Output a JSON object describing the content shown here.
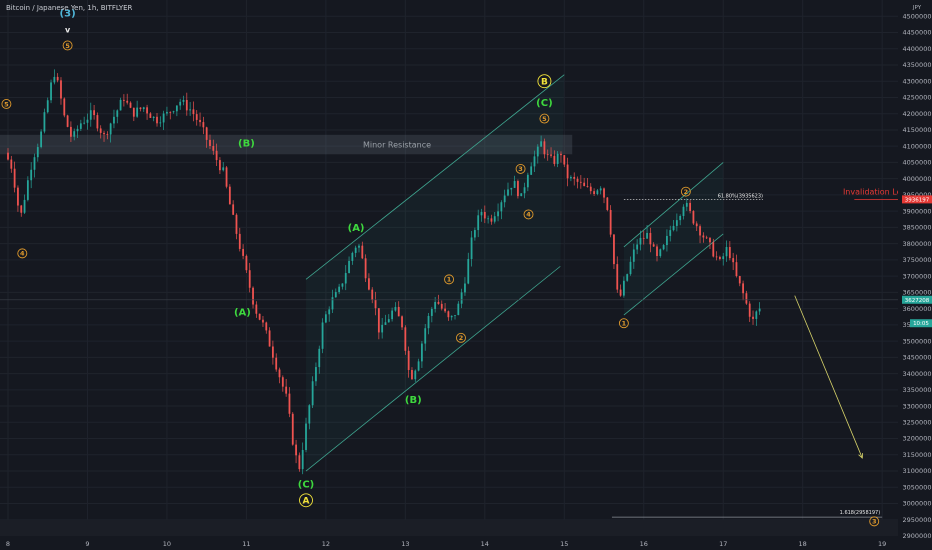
{
  "header": {
    "title": "Bitcoin / Japanese Yen, 1h, BITFLYER",
    "currency": "JPY"
  },
  "colors": {
    "background": "#151820",
    "bull": "#26a69a",
    "bear": "#ef5350",
    "wave_green": "#3ed83e",
    "wave_orange": "#e09a2c",
    "wave_yellow": "#f2e33a",
    "wave_cyan": "#4fb6d8",
    "invalidation": "#e53935",
    "forecast_arrow": "#d8d46a"
  },
  "chart_data": {
    "type": "candlestick",
    "symbol": "Bitcoin / Japanese Yen",
    "interval": "1h",
    "exchange": "BITFLYER",
    "y_range": [
      2900000,
      4550000
    ],
    "y_ticks": [
      2900000,
      2950000,
      3000000,
      3050000,
      3100000,
      3150000,
      3200000,
      3250000,
      3300000,
      3350000,
      3400000,
      3450000,
      3500000,
      3550000,
      3600000,
      3650000,
      3700000,
      3750000,
      3800000,
      3850000,
      3900000,
      3950000,
      4000000,
      4050000,
      4100000,
      4150000,
      4200000,
      4250000,
      4300000,
      4350000,
      4400000,
      4450000,
      4500000
    ],
    "y_tick_labels": [
      "2900000",
      "2950000",
      "3000000",
      "3050000",
      "3100000",
      "3150000",
      "3200000",
      "3250000",
      "3300000",
      "3350000",
      "3400000",
      "3450000",
      "3500000",
      "3550000",
      "3600000",
      "3650000",
      "3700000",
      "3750000",
      "3800000",
      "3850000",
      "3900000",
      "3950000",
      "4000000",
      "4050000",
      "4100000",
      "4150000",
      "4200000",
      "4250000",
      "4300000",
      "4350000",
      "4400000",
      "4450000",
      "4500000"
    ],
    "x_range": [
      8,
      19.3
    ],
    "x_ticks": [
      8,
      9,
      10,
      11,
      12,
      13,
      14,
      15,
      16,
      17,
      18,
      19
    ],
    "x_tick_labels": [
      "8",
      "9",
      "10",
      "11",
      "12",
      "13",
      "14",
      "15",
      "16",
      "17",
      "18",
      "19"
    ],
    "price_path": [
      [
        8.0,
        4080000
      ],
      [
        8.1,
        4030000
      ],
      [
        8.15,
        3940000
      ],
      [
        8.2,
        3880000
      ],
      [
        8.28,
        3980000
      ],
      [
        8.35,
        4060000
      ],
      [
        8.45,
        4130000
      ],
      [
        8.55,
        4250000
      ],
      [
        8.62,
        4330000
      ],
      [
        8.68,
        4280000
      ],
      [
        8.75,
        4190000
      ],
      [
        8.85,
        4120000
      ],
      [
        8.95,
        4170000
      ],
      [
        9.1,
        4200000
      ],
      [
        9.25,
        4130000
      ],
      [
        9.35,
        4180000
      ],
      [
        9.5,
        4250000
      ],
      [
        9.6,
        4200000
      ],
      [
        9.75,
        4220000
      ],
      [
        9.9,
        4180000
      ],
      [
        10.05,
        4200000
      ],
      [
        10.2,
        4240000
      ],
      [
        10.35,
        4210000
      ],
      [
        10.45,
        4170000
      ],
      [
        10.6,
        4090000
      ],
      [
        10.75,
        4020000
      ],
      [
        10.85,
        3900000
      ],
      [
        10.95,
        3800000
      ],
      [
        11.05,
        3700000
      ],
      [
        11.15,
        3600000
      ],
      [
        11.25,
        3550000
      ],
      [
        11.35,
        3480000
      ],
      [
        11.45,
        3400000
      ],
      [
        11.55,
        3320000
      ],
      [
        11.62,
        3200000
      ],
      [
        11.7,
        3100000
      ],
      [
        11.8,
        3250000
      ],
      [
        11.9,
        3400000
      ],
      [
        12.0,
        3550000
      ],
      [
        12.1,
        3620000
      ],
      [
        12.2,
        3650000
      ],
      [
        12.3,
        3720000
      ],
      [
        12.4,
        3790000
      ],
      [
        12.45,
        3800000
      ],
      [
        12.55,
        3700000
      ],
      [
        12.65,
        3620000
      ],
      [
        12.72,
        3520000
      ],
      [
        12.8,
        3560000
      ],
      [
        12.9,
        3600000
      ],
      [
        13.0,
        3550000
      ],
      [
        13.05,
        3470000
      ],
      [
        13.1,
        3380000
      ],
      [
        13.2,
        3440000
      ],
      [
        13.3,
        3550000
      ],
      [
        13.42,
        3630000
      ],
      [
        13.5,
        3600000
      ],
      [
        13.6,
        3560000
      ],
      [
        13.7,
        3600000
      ],
      [
        13.8,
        3700000
      ],
      [
        13.9,
        3840000
      ],
      [
        14.0,
        3900000
      ],
      [
        14.1,
        3870000
      ],
      [
        14.2,
        3910000
      ],
      [
        14.3,
        3960000
      ],
      [
        14.4,
        3990000
      ],
      [
        14.5,
        3940000
      ],
      [
        14.6,
        4040000
      ],
      [
        14.7,
        4080000
      ],
      [
        14.75,
        4110000
      ],
      [
        14.82,
        4070000
      ],
      [
        14.9,
        4050000
      ],
      [
        15.0,
        4080000
      ],
      [
        15.05,
        4020000
      ],
      [
        15.1,
        4000000
      ],
      [
        15.2,
        3990000
      ],
      [
        15.3,
        3970000
      ],
      [
        15.4,
        3960000
      ],
      [
        15.5,
        3980000
      ],
      [
        15.6,
        3900000
      ],
      [
        15.65,
        3780000
      ],
      [
        15.7,
        3650000
      ],
      [
        15.75,
        3640000
      ],
      [
        15.85,
        3720000
      ],
      [
        15.95,
        3800000
      ],
      [
        16.1,
        3830000
      ],
      [
        16.2,
        3750000
      ],
      [
        16.3,
        3790000
      ],
      [
        16.4,
        3860000
      ],
      [
        16.5,
        3900000
      ],
      [
        16.55,
        3930000
      ],
      [
        16.65,
        3880000
      ],
      [
        16.75,
        3840000
      ],
      [
        16.9,
        3780000
      ],
      [
        17.0,
        3740000
      ],
      [
        17.1,
        3790000
      ],
      [
        17.2,
        3700000
      ],
      [
        17.3,
        3640000
      ],
      [
        17.35,
        3600000
      ],
      [
        17.42,
        3560000
      ],
      [
        17.48,
        3600000
      ]
    ],
    "last_price": 3627208,
    "last_price_label": "3627208",
    "countdown_label": "10:05",
    "invalidation": {
      "value": 3936197,
      "label": "Invalidation Level",
      "value_label": "3936197"
    },
    "fib_levels": [
      {
        "label": "61.80%(3935623)",
        "value": 3935623
      },
      {
        "label": "1.618(2958197)",
        "value": 2958197
      }
    ],
    "minor_resistance": {
      "label": "Minor Resistance",
      "from": 4075000,
      "to": 4135000
    },
    "forecast": {
      "from": [
        17.9,
        3640000
      ],
      "to": [
        18.75,
        3140000
      ]
    },
    "wave_labels": [
      {
        "text": "(3)",
        "x": 8.75,
        "y": 4510000,
        "color": "cyan",
        "shape": "plain"
      },
      {
        "text": "v",
        "x": 8.75,
        "y": 4460000,
        "color": "white",
        "shape": "plain"
      },
      {
        "text": "5",
        "x": 8.75,
        "y": 4410000,
        "color": "orange",
        "shape": "circle"
      },
      {
        "text": "4",
        "x": 8.18,
        "y": 3770000,
        "color": "orange",
        "shape": "circle"
      },
      {
        "text": "(B)",
        "x": 11.0,
        "y": 4110000,
        "color": "green",
        "shape": "plain"
      },
      {
        "text": "(A)",
        "x": 10.95,
        "y": 3590000,
        "color": "green",
        "shape": "plain"
      },
      {
        "text": "(C)",
        "x": 11.75,
        "y": 3060000,
        "color": "green",
        "shape": "plain"
      },
      {
        "text": "A",
        "x": 11.75,
        "y": 3010000,
        "color": "yellow",
        "shape": "circle"
      },
      {
        "text": "(A)",
        "x": 12.38,
        "y": 3850000,
        "color": "green",
        "shape": "plain"
      },
      {
        "text": "(B)",
        "x": 13.1,
        "y": 3320000,
        "color": "green",
        "shape": "plain"
      },
      {
        "text": "1",
        "x": 13.55,
        "y": 3690000,
        "color": "orange",
        "shape": "circle"
      },
      {
        "text": "2",
        "x": 13.7,
        "y": 3510000,
        "color": "orange",
        "shape": "circle"
      },
      {
        "text": "3",
        "x": 14.45,
        "y": 4030000,
        "color": "orange",
        "shape": "circle"
      },
      {
        "text": "4",
        "x": 14.55,
        "y": 3890000,
        "color": "orange",
        "shape": "circle"
      },
      {
        "text": "B",
        "x": 14.75,
        "y": 4300000,
        "color": "yellow",
        "shape": "circle"
      },
      {
        "text": "(C)",
        "x": 14.75,
        "y": 4235000,
        "color": "green",
        "shape": "plain"
      },
      {
        "text": "5",
        "x": 14.75,
        "y": 4185000,
        "color": "orange",
        "shape": "circle"
      },
      {
        "text": "1",
        "x": 15.75,
        "y": 3555000,
        "color": "orange",
        "shape": "circle"
      },
      {
        "text": "2",
        "x": 16.53,
        "y": 3960000,
        "color": "orange",
        "shape": "circle"
      },
      {
        "text": "3",
        "x": 18.9,
        "y": 2945000,
        "color": "orange",
        "shape": "circle"
      },
      {
        "text": "5",
        "x": 7.98,
        "y": 4230000,
        "color": "orange",
        "shape": "circle"
      }
    ],
    "channels": [
      {
        "lower": [
          [
            11.75,
            3100000
          ],
          [
            14.95,
            3730000
          ]
        ],
        "upper": [
          [
            11.75,
            3690000
          ],
          [
            15.0,
            4320000
          ]
        ]
      },
      {
        "lower": [
          [
            15.75,
            3580000
          ],
          [
            17.0,
            3830000
          ]
        ],
        "upper": [
          [
            15.75,
            3790000
          ],
          [
            17.0,
            4050000
          ]
        ]
      }
    ]
  }
}
